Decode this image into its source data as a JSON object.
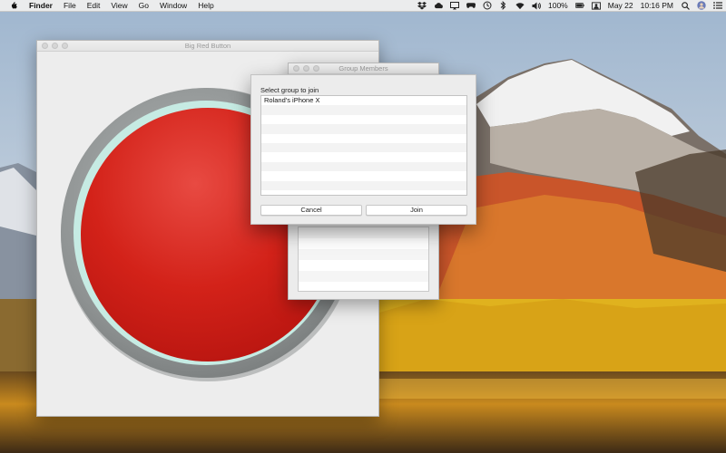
{
  "menubar": {
    "app_name": "Finder",
    "items": [
      "File",
      "Edit",
      "View",
      "Go",
      "Window",
      "Help"
    ],
    "battery": "100%",
    "date": "May 22",
    "time": "10:16 PM"
  },
  "main_window": {
    "title": "Big Red Button"
  },
  "group_window": {
    "title": "Group Members"
  },
  "sheet": {
    "label": "Select group to join",
    "rows": [
      "Roland's iPhone X",
      "",
      "",
      "",
      "",
      "",
      "",
      "",
      "",
      ""
    ],
    "cancel_label": "Cancel",
    "join_label": "Join"
  },
  "colors": {
    "button_red": "#d21e17",
    "button_ring": "#8c9090",
    "button_glow": "#c9ece4"
  }
}
